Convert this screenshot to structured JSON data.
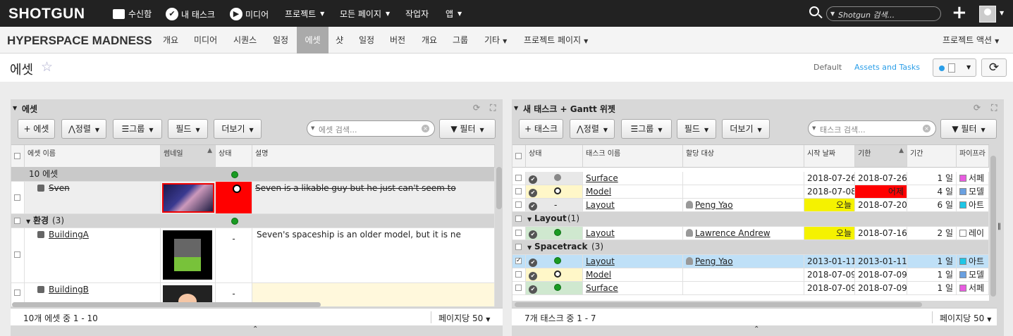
{
  "topnav": {
    "logo": "SHOTGUN",
    "inbox": "수신함",
    "my_tasks": "내 태스크",
    "media": "미디어",
    "projects": "프로젝트",
    "all_pages": "모든 페이지",
    "workers": "작업자",
    "apps": "앱",
    "search_placeholder": "Shotgun 검색..."
  },
  "project": {
    "name": "HYPERSPACE MADNESS",
    "tabs": [
      {
        "label": "개요"
      },
      {
        "label": "미디어"
      },
      {
        "label": "시퀀스"
      },
      {
        "label": "일정"
      },
      {
        "label": "에셋",
        "active": true
      },
      {
        "label": "샷"
      },
      {
        "label": "일정"
      },
      {
        "label": "버전"
      },
      {
        "label": "개요"
      },
      {
        "label": "그룹"
      },
      {
        "label": "기타"
      },
      {
        "label": "프로젝트 페이지"
      }
    ],
    "actions": "프로젝트 액션"
  },
  "page": {
    "title": "에셋",
    "view_default": "Default",
    "view_assets_tasks": "Assets and Tasks"
  },
  "left": {
    "title": "에셋",
    "add": "+ 에셋",
    "sort": "정렬",
    "group": "그룹",
    "fields": "필드",
    "more": "더보기",
    "search_placeholder": "에셋 검색...",
    "filter": "필터",
    "columns": [
      "에셋 이름",
      "썸네일",
      "상태",
      "설명"
    ],
    "group1": "10 에셋",
    "row1_name": "Sven",
    "row1_desc": "Seven is a likable guy but he just can't seem to",
    "group2": "환경",
    "group2_count": "(3)",
    "row2_name": "BuildingA",
    "row2_status": "-",
    "row2_desc": "Seven's spaceship is an older model, but it is ne",
    "row3_name": "BuildingB",
    "row3_status": "-",
    "footer_count": "10개 에셋 중 1 - 10",
    "per_page": "페이지당 50"
  },
  "right": {
    "title": "새 태스크 + Gantt 위젯",
    "add": "+ 태스크",
    "sort": "정렬",
    "group": "그룹",
    "fields": "필드",
    "more": "더보기",
    "search_placeholder": "태스크 검색...",
    "filter": "필터",
    "columns": [
      "상태",
      "태스크 이름",
      "할당 대상",
      "시작 날짜",
      "기한",
      "기간",
      "파이프라"
    ],
    "rows": [
      {
        "name": "Surface",
        "assignee": "",
        "start": "2018-07-26",
        "due": "2018-07-26",
        "dur": "1 일",
        "pipe": "서페",
        "color": "#e85ce0",
        "dot": "gray"
      },
      {
        "name": "Model",
        "assignee": "",
        "start": "2018-07-08",
        "due": "어제",
        "dur": "4 일",
        "pipe": "모델",
        "color": "#6aa0e0",
        "dot": "ring"
      },
      {
        "name": "Layout",
        "assignee": "Peng Yao",
        "start": "오늘",
        "due": "2018-07-20",
        "dur": "6 일",
        "pipe": "아트",
        "color": "#1ec6e6",
        "dot": "dash"
      }
    ],
    "group_layout": "Layout",
    "group_layout_count": "(1)",
    "layout_row": {
      "name": "Layout",
      "assignee": "Lawrence Andrew",
      "start": "오늘",
      "due": "2018-07-16",
      "dur": "2 일",
      "pipe": "레이"
    },
    "group_space": "Spacetrack",
    "group_space_count": "(3)",
    "space_rows": [
      {
        "name": "Layout",
        "assignee": "Peng Yao",
        "start": "2013-01-11",
        "due": "2013-01-11",
        "dur": "1 일",
        "pipe": "아트",
        "color": "#1ec6e6",
        "dot": "green"
      },
      {
        "name": "Model",
        "assignee": "",
        "start": "2018-07-09",
        "due": "2018-07-09",
        "dur": "1 일",
        "pipe": "모델",
        "color": "#6aa0e0",
        "dot": "ring"
      },
      {
        "name": "Surface",
        "assignee": "",
        "start": "2018-07-09",
        "due": "2018-07-09",
        "dur": "1 일",
        "pipe": "서페",
        "color": "#e85ce0",
        "dot": "green"
      }
    ],
    "footer_count": "7개 태스크 중 1 - 7",
    "per_page": "페이지당 50"
  }
}
